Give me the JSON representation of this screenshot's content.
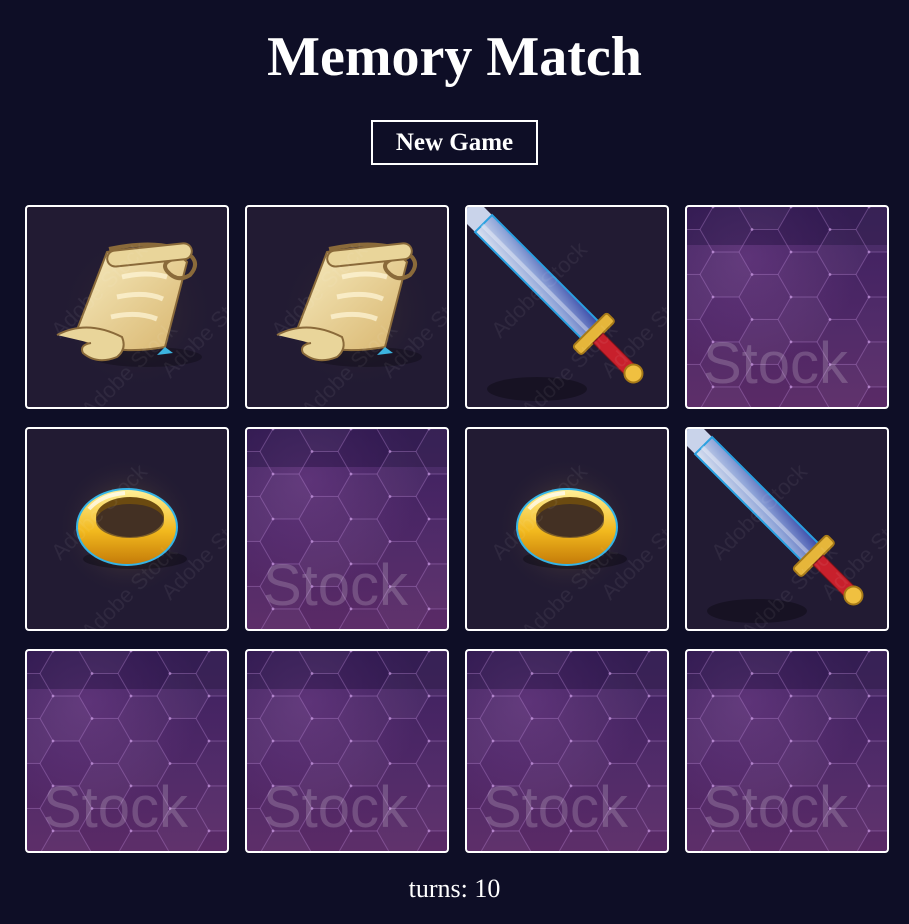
{
  "title": "Memory Match",
  "new_game_label": "New Game",
  "turns_label": "turns:",
  "turns_value": 10,
  "colors": {
    "background": "#0e0e26",
    "card_face": "#221b33",
    "card_back": "#4d2766",
    "text": "#ffffff"
  },
  "card_back_watermark": "Stock",
  "card_face_watermark": "Adobe Stock",
  "cards": [
    {
      "state": "face-up",
      "icon": "scroll"
    },
    {
      "state": "face-up",
      "icon": "scroll"
    },
    {
      "state": "face-up",
      "icon": "sword"
    },
    {
      "state": "face-down"
    },
    {
      "state": "face-up",
      "icon": "ring"
    },
    {
      "state": "face-down"
    },
    {
      "state": "face-up",
      "icon": "ring"
    },
    {
      "state": "face-up",
      "icon": "sword"
    },
    {
      "state": "face-down"
    },
    {
      "state": "face-down"
    },
    {
      "state": "face-down"
    },
    {
      "state": "face-down"
    }
  ]
}
